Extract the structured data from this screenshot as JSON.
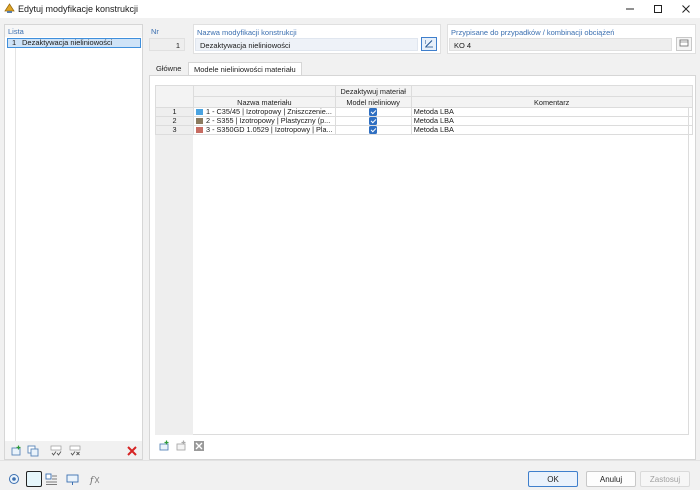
{
  "window": {
    "title": "Edytuj modyfikacje konstrukcji",
    "minimize_icon": "minimize-icon",
    "maximize_icon": "maximize-icon",
    "close_icon": "close-icon"
  },
  "list": {
    "header": "Lista",
    "items": [
      {
        "nr": "1",
        "label": "Dezaktywacja nieliniowości"
      }
    ]
  },
  "fields": {
    "nr_label": "Nr",
    "nr_value": "1",
    "name_label": "Nazwa modyfikacji konstrukcji",
    "name_value": "Dezaktywacja nieliniowości",
    "assigned_label": "Przypisane do przypadków / kombinacji obciążeń",
    "assigned_value": "KO 4"
  },
  "tabs": [
    {
      "label": "Główne",
      "active": false
    },
    {
      "label": "Modele nieliniowości materiału",
      "active": true
    }
  ],
  "table": {
    "columns": {
      "material_name": "Nazwa materiału",
      "deactivate_line1": "Dezaktywuj materiał",
      "deactivate_line2": "Model nieliniowy",
      "comment": "Komentarz"
    },
    "rows": [
      {
        "nr": "1",
        "material": "1 - C35/45 | Izotropowy | Zniszczenie...",
        "color": "#4aa3e0",
        "deactivate": true,
        "comment": "Metoda LBA"
      },
      {
        "nr": "2",
        "material": "2 - S355 | Izotropowy | Plastyczny (p...",
        "color": "#8a7a5e",
        "deactivate": true,
        "comment": "Metoda LBA"
      },
      {
        "nr": "3",
        "material": "3 - S350GD 1.0529 | Izotropowy | Pla...",
        "color": "#c76c62",
        "deactivate": true,
        "comment": "Metoda LBA"
      }
    ]
  },
  "buttons": {
    "ok": "OK",
    "cancel": "Anuluj",
    "apply": "Zastosuj"
  },
  "colors": {
    "accent": "#3f7fcc",
    "label_blue": "#3b6fb0",
    "delete_red": "#d62424"
  }
}
